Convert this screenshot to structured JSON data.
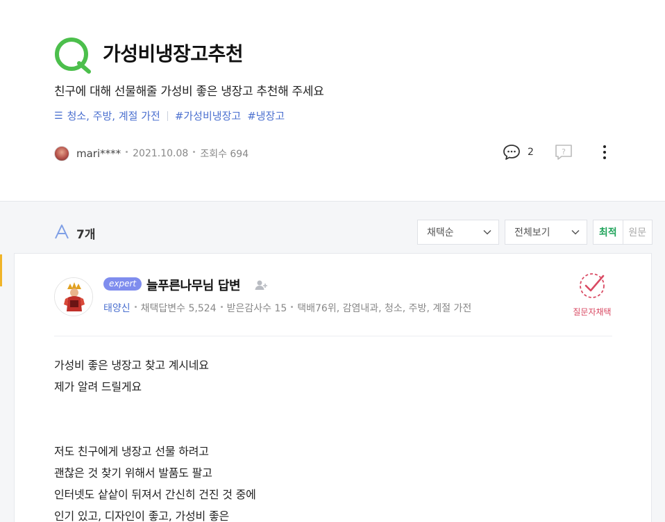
{
  "question": {
    "title": "가성비냉장고추천",
    "body": "친구에 대해 선물해줄 가성비 좋은 냉장고 추천해 주세요",
    "category": "청소, 주방, 계절 가전",
    "tags": [
      "#가성비냉장고",
      "#냉장고"
    ],
    "author": "mari****",
    "date": "2021.10.08",
    "views": "조회수 694",
    "comment_count": "2"
  },
  "answers": {
    "count": "7개",
    "sort_select": "채택순",
    "view_select": "전체보기",
    "toggle_latest": "최적",
    "toggle_original": "원문"
  },
  "answer": {
    "badge": "expert",
    "name": "늘푸른나무님 답변",
    "meta_link": "태양신",
    "meta_items": [
      "채택답변수 5,524",
      "받은감사수 15",
      "택배76위, 감염내과, 청소, 주방, 계절 가전"
    ],
    "choose_label": "질문자채택",
    "body": [
      "가성비 좋은 냉장고 찾고 계시네요",
      "제가 알려 드릴게요",
      "",
      "",
      "저도 친구에게 냉장고 선물 하려고",
      "괜찮은 것 찾기 위해서 발품도 팔고",
      "인터넷도 샅샅이 뒤져서 간신히 건진 것 중에",
      "인기 있고, 디자인이 좋고, 가성비 좋은"
    ]
  },
  "colors": {
    "brand_green": "#4cbf4c",
    "link_blue": "#4a6fcf",
    "expert_badge": "#7f8dee",
    "choose_red": "#d94a63",
    "marker_yellow": "#f0b429"
  },
  "icons": [
    "q-icon",
    "menu-icon",
    "comment-icon",
    "report-icon",
    "more-icon",
    "a-icon",
    "chevron-down-icon",
    "add-user-icon",
    "check-circle-icon"
  ]
}
